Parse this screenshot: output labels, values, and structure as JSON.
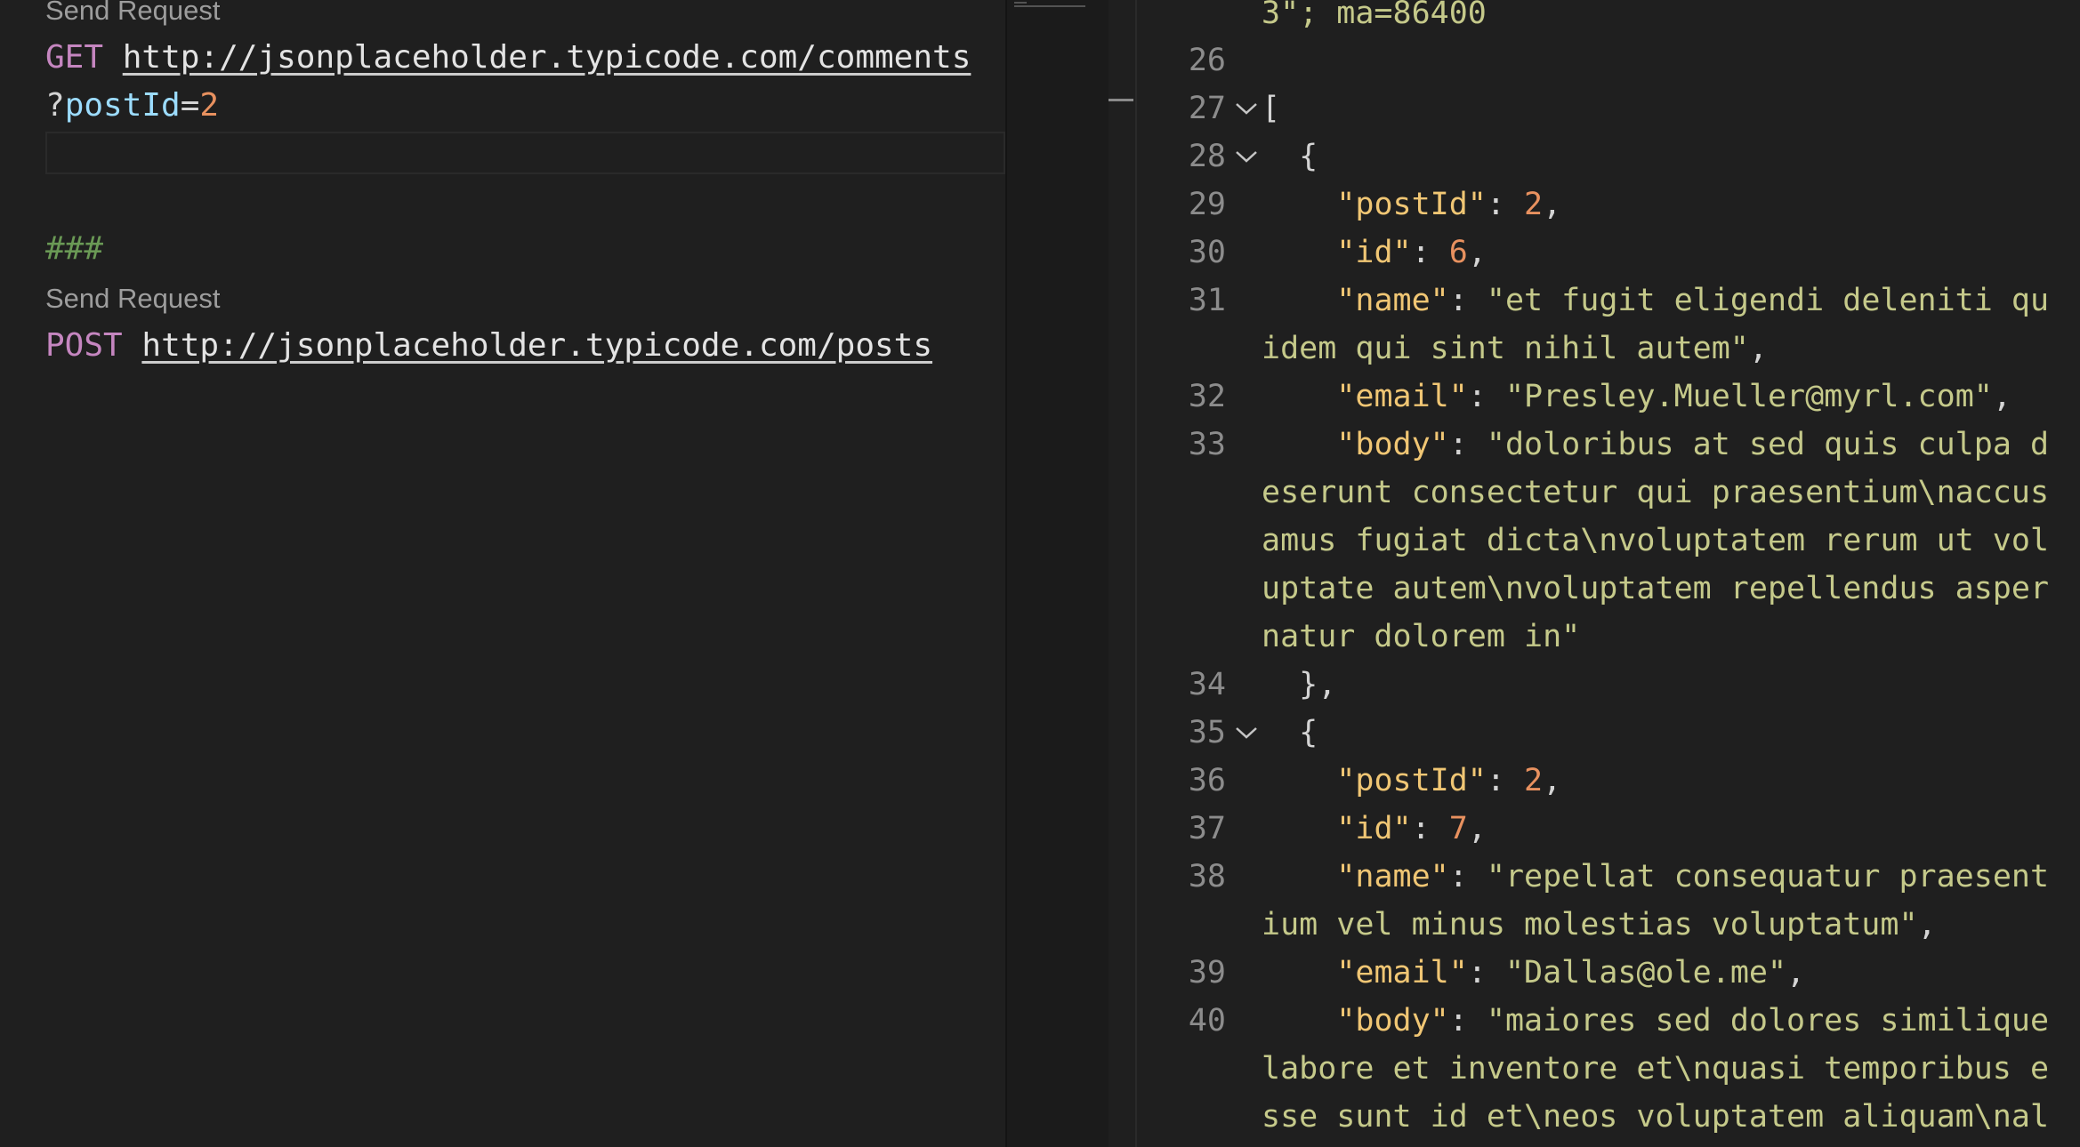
{
  "request_editor": {
    "send_request_1": "Send Request",
    "get_method": "GET",
    "get_url": "http://jsonplaceholder.typicode.com/comments",
    "query_prefix": "?",
    "query_param": "postId",
    "query_eq": "=",
    "query_value": "2",
    "separator": "###",
    "send_request_2": "Send Request",
    "post_method": "POST",
    "post_url": "http://jsonplaceholder.typicode.com/posts"
  },
  "response_viewer": {
    "header_tail": "3\"; ma=86400",
    "lines": [
      {
        "num": "26",
        "text": ""
      },
      {
        "num": "27",
        "text": "["
      },
      {
        "num": "28",
        "text": "  {"
      },
      {
        "num": "29",
        "key": "\"postId\"",
        "num_val": "2"
      },
      {
        "num": "30",
        "key": "\"id\"",
        "num_val": "6"
      },
      {
        "num": "31",
        "key": "\"name\"",
        "str_1": "\"et fugit eligendi deleniti qu",
        "str_2": "idem qui sint nihil autem\""
      },
      {
        "num": "32",
        "key": "\"email\"",
        "str_1": "\"Presley.Mueller@myrl.com\""
      },
      {
        "num": "33",
        "key": "\"body\"",
        "str_1": "\"doloribus at sed quis culpa d",
        "str_2": "eserunt consectetur qui praesentium\\naccus",
        "str_3": "amus fugiat dicta\\nvoluptatem rerum ut vol",
        "str_4": "uptate autem\\nvoluptatem repellendus asper",
        "str_5": "natur dolorem in\""
      },
      {
        "num": "34",
        "text": "  },"
      },
      {
        "num": "35",
        "text": "  {"
      },
      {
        "num": "36",
        "key": "\"postId\"",
        "num_val": "2"
      },
      {
        "num": "37",
        "key": "\"id\"",
        "num_val": "7"
      },
      {
        "num": "38",
        "key": "\"name\"",
        "str_1": "\"repellat consequatur praesent",
        "str_2": "ium vel minus molestias voluptatum\""
      },
      {
        "num": "39",
        "key": "\"email\"",
        "str_1": "\"Dallas@ole.me\""
      },
      {
        "num": "40",
        "key": "\"body\"",
        "str_1": "\"maiores sed dolores similique",
        "str_2": "labore et inventore et\\nquasi temporibus e",
        "str_3": "sse sunt id et\\neos voluptatem aliquam\\nal"
      }
    ]
  },
  "colors": {
    "background": "#1f1f1f",
    "keyword": "#c586c0",
    "json_key": "#f0c674",
    "json_string": "#c5c98a",
    "json_number": "#e8915f",
    "comment": "#6a9955"
  },
  "icons": {
    "fold": "chevron-down-icon"
  }
}
